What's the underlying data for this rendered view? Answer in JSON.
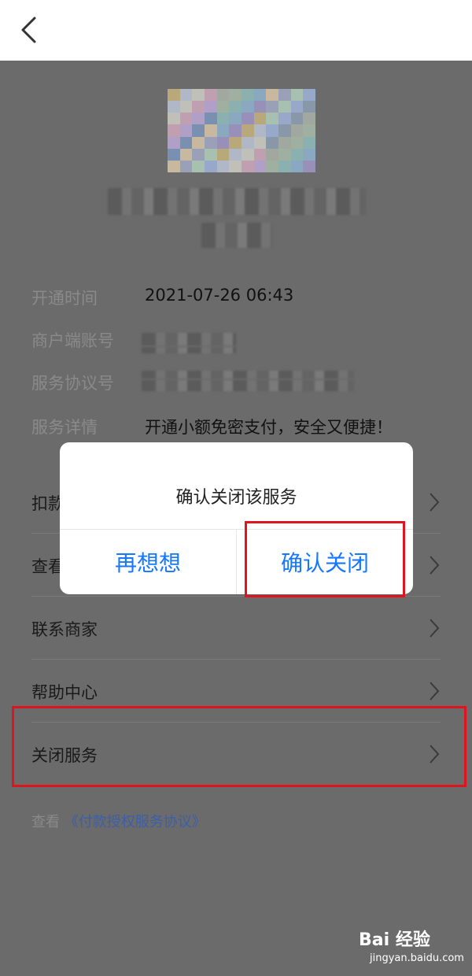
{
  "info": [
    {
      "label": "开通时间",
      "value": "2021-07-26 06:43"
    },
    {
      "label": "商户端账号",
      "value": ""
    },
    {
      "label": "服务协议号",
      "value": ""
    },
    {
      "label": "服务详情",
      "value": "开通小额免密支付，安全又便捷！"
    }
  ],
  "list": [
    {
      "label": "扣款"
    },
    {
      "label": "查看"
    },
    {
      "label": "联系商家"
    },
    {
      "label": "帮助中心"
    },
    {
      "label": "关闭服务"
    }
  ],
  "agreement": {
    "prefix": "查看",
    "link": "《付款授权服务协议》"
  },
  "dialog": {
    "title": "确认关闭该服务",
    "cancel_label": "再想想",
    "confirm_label": "确认关闭"
  },
  "watermark": {
    "main": "Bai 经验",
    "sub": "jingyan.baidu.com"
  },
  "colors": {
    "accent": "#1677ff",
    "highlight": "#e0141e",
    "overlay": "#6b6b6b"
  },
  "icons": {
    "back": "chevron-left-icon",
    "row": "chevron-right-icon"
  }
}
